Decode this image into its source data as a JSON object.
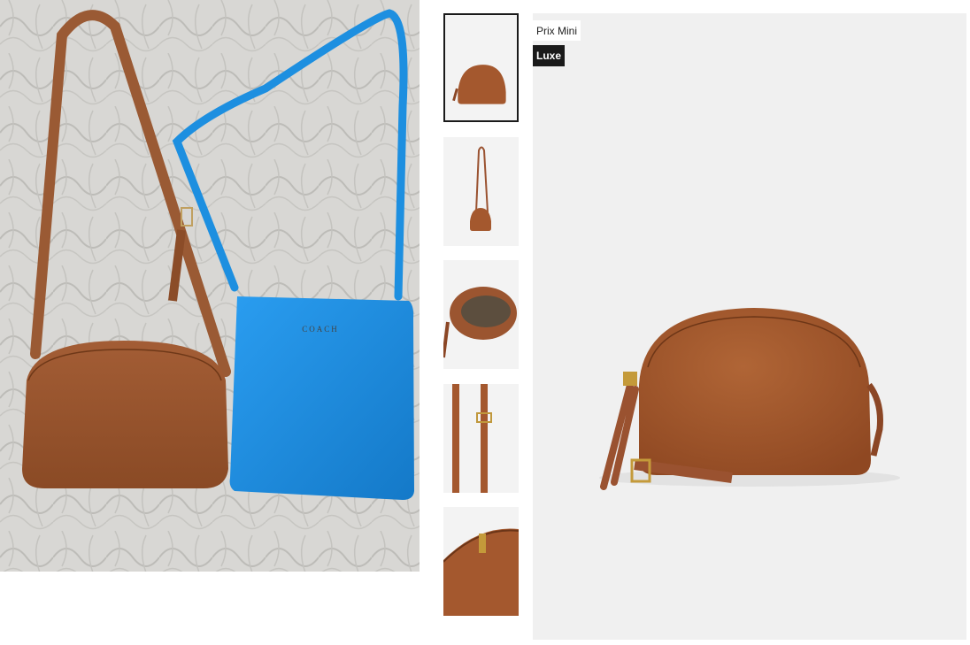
{
  "badges": {
    "category": "Prix Mini",
    "tier": "Luxe"
  },
  "colors": {
    "leather_tan": "#a4582e",
    "strap_blue": "#1d8fe0",
    "panel_bg": "#f0f0f0",
    "luxe_badge_bg": "#1a1a1a"
  },
  "gallery": {
    "thumbnails": [
      {
        "name": "thumb-front",
        "active": true
      },
      {
        "name": "thumb-full-strap",
        "active": false
      },
      {
        "name": "thumb-open-top",
        "active": false
      },
      {
        "name": "thumb-strap-detail",
        "active": false
      },
      {
        "name": "thumb-zipper-detail",
        "active": false
      }
    ]
  },
  "photo": {
    "brand_mark": "COACH"
  }
}
